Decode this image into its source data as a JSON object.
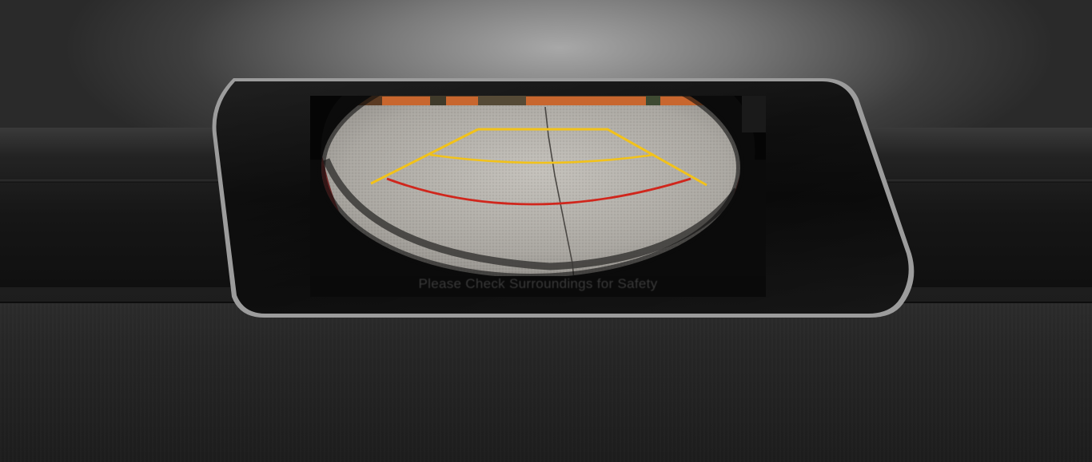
{
  "display": {
    "mode": "rear-view-camera",
    "warning_text": "Please Check Surroundings for Safety"
  },
  "guide_lines": {
    "distance_guide_color": "#f2c21a",
    "stop_line_color": "#d0261c"
  },
  "colors": {
    "bezel": "#0d0d0d",
    "bezel_trim": "#b9b9b9",
    "pavement": "#b4b1ab"
  }
}
